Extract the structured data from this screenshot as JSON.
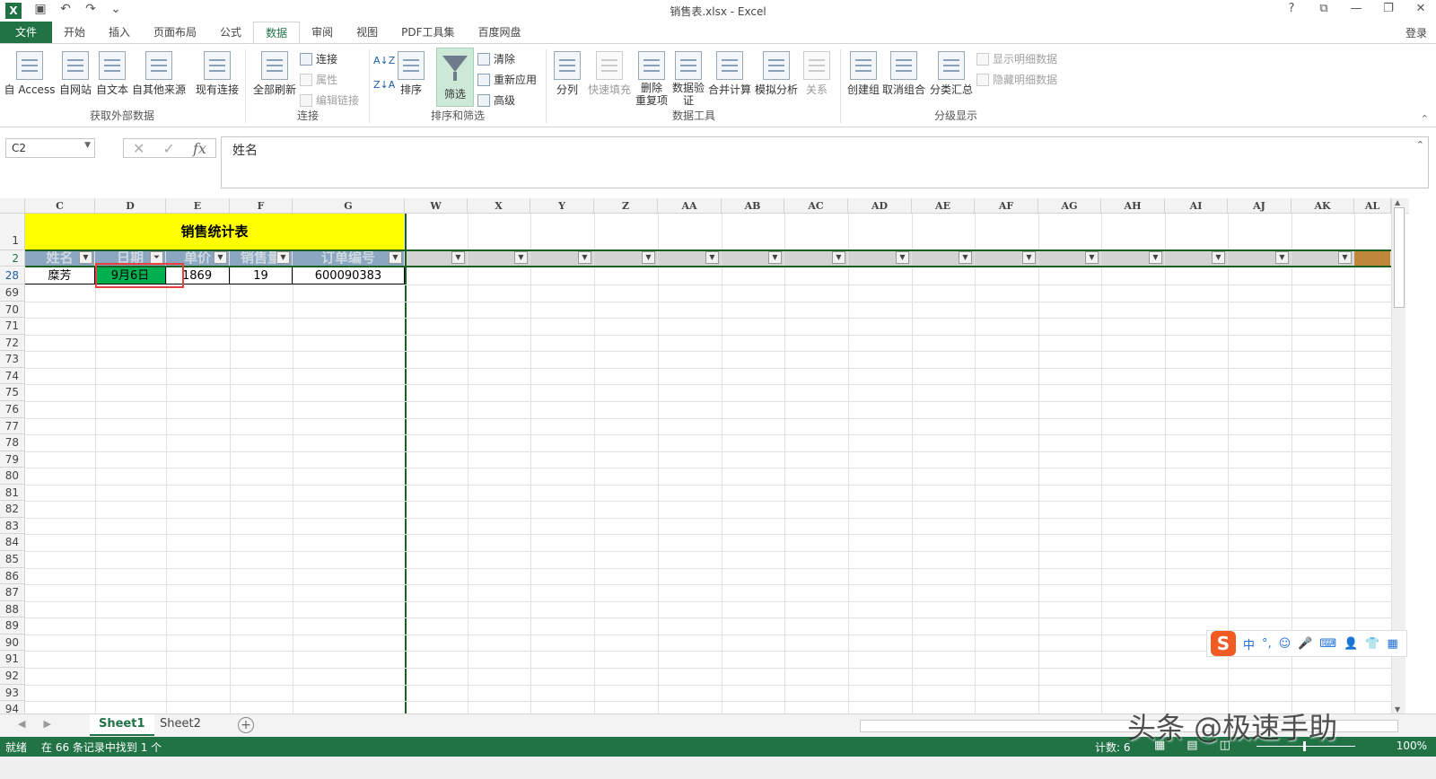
{
  "window": {
    "title": "销售表.xlsx - Excel",
    "help": "?",
    "controls": [
      "?",
      "⧉",
      "—",
      "❐",
      "✕"
    ]
  },
  "qat": {
    "save_icon": "save-icon",
    "undo_icon": "undo-icon",
    "redo_icon": "redo-icon"
  },
  "tabs": [
    "文件",
    "开始",
    "插入",
    "页面布局",
    "公式",
    "数据",
    "审阅",
    "视图",
    "PDF工具集",
    "百度网盘"
  ],
  "active_tab": "数据",
  "login": "登录",
  "ribbon": {
    "groups": {
      "external": "获取外部数据",
      "connections": "连接",
      "sortfilter": "排序和筛选",
      "datatools": "数据工具",
      "outline": "分级显示"
    },
    "buttons": {
      "access": "自 Access",
      "web": "自网站",
      "text": "自文本",
      "other": "自其他来源",
      "existing": "现有连接",
      "refresh": "全部刷新",
      "connections": "连接",
      "properties": "属性",
      "edit_links": "编辑链接",
      "sort": "排序",
      "filter": "筛选",
      "clear": "清除",
      "reapply": "重新应用",
      "advanced": "高级",
      "split": "分列",
      "flash_fill": "快速填充",
      "remove_dup": "删除\n重复项",
      "validation": "数据验\n证",
      "consolidate": "合并计算",
      "whatif": "模拟分析",
      "relations": "关系",
      "group": "创建组",
      "ungroup": "取消组合",
      "subtotal": "分类汇总",
      "show_detail": "显示明细数据",
      "hide_detail": "隐藏明细数据"
    }
  },
  "formula_bar": {
    "name_box": "C2",
    "content": "姓名",
    "cancel": "✕",
    "enter": "✓",
    "fx": "fx"
  },
  "columns": [
    "C",
    "D",
    "E",
    "F",
    "G",
    "W",
    "X",
    "Y",
    "Z",
    "AA",
    "AB",
    "AC",
    "AD",
    "AE",
    "AF",
    "AG",
    "AH",
    "AI",
    "AJ",
    "AK",
    "AL"
  ],
  "sheet": {
    "title": "销售统计表",
    "headers": [
      "姓名",
      "日期",
      "单价",
      "销售量",
      "订单编号"
    ],
    "row28": {
      "name": "糜芳",
      "date": "9月6日",
      "price": "1869",
      "qty": "19",
      "order": "600090383"
    }
  },
  "row_numbers": [
    "1",
    "2",
    "28",
    "69",
    "70",
    "71",
    "72",
    "73",
    "74",
    "75",
    "76",
    "77",
    "78",
    "79",
    "80",
    "81",
    "82",
    "83",
    "84",
    "85",
    "86",
    "87",
    "88",
    "89",
    "90",
    "91",
    "92",
    "93",
    "94"
  ],
  "sheets": [
    "Sheet1",
    "Sheet2"
  ],
  "status": {
    "ready": "就绪",
    "message": "在 66 条记录中找到 1 个",
    "count": "计数: 6",
    "zoom": "100%"
  },
  "ime": {
    "label": "中"
  },
  "watermark": "头条 @极速手助"
}
